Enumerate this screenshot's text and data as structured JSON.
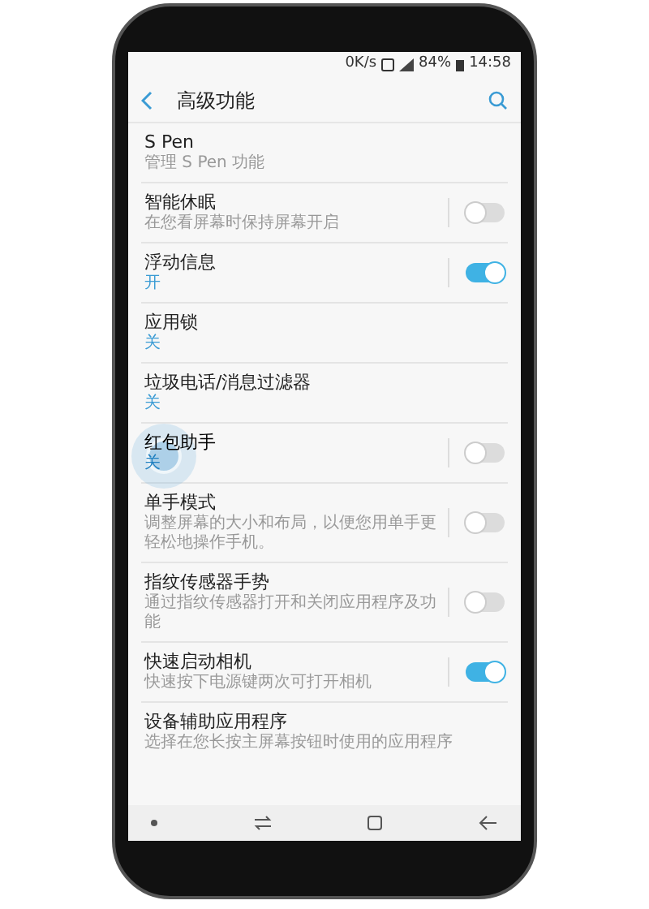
{
  "status_bar": {
    "speed": "0K/s",
    "battery": "84%",
    "time": "14:58"
  },
  "header": {
    "title": "高级功能"
  },
  "items": [
    {
      "kind": "link",
      "title": "S Pen",
      "description": "管理 S Pen 功能"
    },
    {
      "kind": "switch",
      "title": "智能休眠",
      "description": "在您看屏幕时保持屏幕开启",
      "on": false
    },
    {
      "kind": "switch",
      "title": "浮动信息",
      "value": "开",
      "on": true
    },
    {
      "kind": "link",
      "title": "应用锁",
      "value": "关"
    },
    {
      "kind": "link",
      "title": "垃圾电话/消息过滤器",
      "value": "关"
    },
    {
      "kind": "switch",
      "title": "红包助手",
      "value": "关",
      "on": false,
      "touched": true
    },
    {
      "kind": "switch",
      "title": "单手模式",
      "description": "调整屏幕的大小和布局，以便您用单手更轻松地操作手机。",
      "on": false
    },
    {
      "kind": "switch",
      "title": "指纹传感器手势",
      "description": "通过指纹传感器打开和关闭应用程序及功能",
      "on": false
    },
    {
      "kind": "switch",
      "title": "快速启动相机",
      "description": "快速按下电源键两次可打开相机",
      "on": true
    },
    {
      "kind": "link",
      "title": "设备辅助应用程序",
      "description": "选择在您长按主屏幕按钮时使用的应用程序"
    }
  ]
}
